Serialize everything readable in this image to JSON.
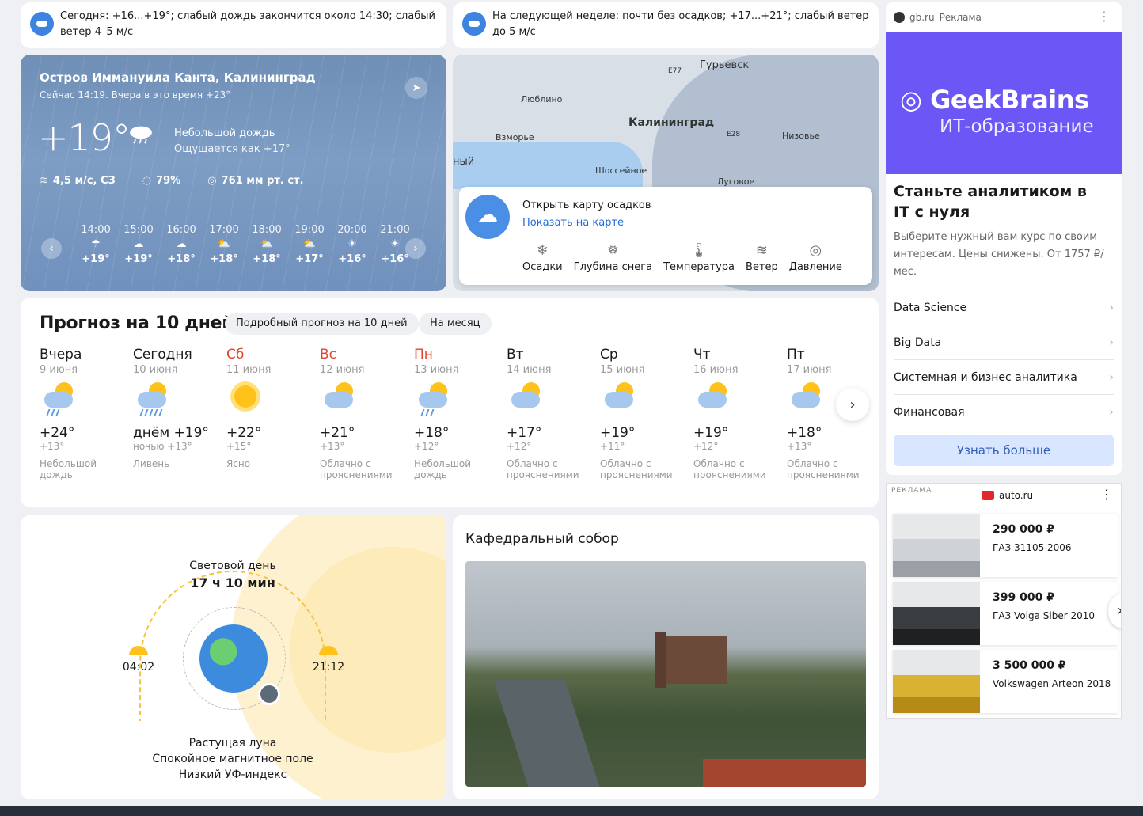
{
  "notices": [
    {
      "text": "Сегодня: +16...+19°; слабый дождь закончится около 14:30; слабый ветер 4–5 м/с"
    },
    {
      "text": "На следующей неделе: почти без осадков; +17...+21°; слабый ветер до 5 м/с"
    }
  ],
  "current": {
    "location": "Остров Иммануила Канта, Калининград",
    "now_line": "Сейчас 14:19. Вчера в это время +23°",
    "temp": "+19°",
    "condition": "Небольшой дождь",
    "feels_like": "Ощущается как +17°",
    "wind": "4,5 м/с, СЗ",
    "humidity": "79%",
    "pressure": "761 мм рт. ст.",
    "hourly": [
      {
        "time": "14:00",
        "temp": "+19°",
        "icon": "rain-cloud-icon"
      },
      {
        "time": "15:00",
        "temp": "+19°",
        "icon": "cloud-icon"
      },
      {
        "time": "16:00",
        "temp": "+18°",
        "icon": "cloud-icon"
      },
      {
        "time": "17:00",
        "temp": "+18°",
        "icon": "partly-cloudy-icon"
      },
      {
        "time": "18:00",
        "temp": "+18°",
        "icon": "partly-cloudy-icon"
      },
      {
        "time": "19:00",
        "temp": "+17°",
        "icon": "partly-cloudy-icon"
      },
      {
        "time": "20:00",
        "temp": "+16°",
        "icon": "sun-icon"
      },
      {
        "time": "21:00",
        "temp": "+16°",
        "icon": "sun-icon"
      }
    ]
  },
  "map": {
    "labels": {
      "guryevsk": "Гурьевск",
      "lyublino": "Люблино",
      "kaliningrad": "Калининград",
      "vzmorye": "Взморье",
      "nizovye": "Низовье",
      "shosseynoye": "Шоссейное",
      "lugovoe": "Луговое",
      "e77": "E77",
      "e28": "E28",
      "left_edge": "ный"
    },
    "open_text": "Открыть карту осадков",
    "show_link": "Показать на карте",
    "layers": [
      "Осадки",
      "Глубина снега",
      "Температура",
      "Ветер",
      "Давление"
    ]
  },
  "forecast": {
    "title": "Прогноз на 10 дней",
    "pill_detailed": "Подробный прогноз на 10 дней",
    "pill_month": "На месяц",
    "days": [
      {
        "name": "Вчера",
        "date": "9 июня",
        "hi": "+24°",
        "lo": "+13°",
        "cond": "Небольшой дождь",
        "red": false,
        "icon": "rain"
      },
      {
        "name": "Сегодня",
        "date": "10 июня",
        "hi": "днём +19°",
        "lo": "ночью +13°",
        "cond": "Ливень",
        "red": false,
        "icon": "shower"
      },
      {
        "name": "Сб",
        "date": "11 июня",
        "hi": "+22°",
        "lo": "+15°",
        "cond": "Ясно",
        "red": true,
        "icon": "sun"
      },
      {
        "name": "Вс",
        "date": "12 июня",
        "hi": "+21°",
        "lo": "+13°",
        "cond": "Облачно с прояснениями",
        "red": true,
        "icon": "partly"
      },
      {
        "name": "Пн",
        "date": "13 июня",
        "hi": "+18°",
        "lo": "+12°",
        "cond": "Небольшой дождь",
        "red": true,
        "icon": "rain"
      },
      {
        "name": "Вт",
        "date": "14 июня",
        "hi": "+17°",
        "lo": "+12°",
        "cond": "Облачно с прояснениями",
        "red": false,
        "icon": "partly"
      },
      {
        "name": "Ср",
        "date": "15 июня",
        "hi": "+19°",
        "lo": "+11°",
        "cond": "Облачно с прояснениями",
        "red": false,
        "icon": "partly"
      },
      {
        "name": "Чт",
        "date": "16 июня",
        "hi": "+19°",
        "lo": "+12°",
        "cond": "Облачно с прояснениями",
        "red": false,
        "icon": "partly"
      },
      {
        "name": "Пт",
        "date": "17 июня",
        "hi": "+18°",
        "lo": "+13°",
        "cond": "Облачно с прояснениями",
        "red": false,
        "icon": "partly"
      }
    ]
  },
  "daylight": {
    "label": "Световой день",
    "duration": "17 ч 10 мин",
    "sunrise": "04:02",
    "sunset": "21:12",
    "moon": "Растущая луна",
    "magnetic": "Спокойное магнитное поле",
    "uv": "Низкий УФ-индекс"
  },
  "cathedral": {
    "title": "Кафедральный собор"
  },
  "ad_geekbrains": {
    "source": "gb.ru",
    "ad_label": "Реклама",
    "brand": "GeekBrains",
    "brand_sub": "ИТ-образование",
    "headline": "Станьте аналитиком в IT с нуля",
    "description": "Выберите нужный вам курс по своим интересам. Цены снижены. От 1757 ₽/мес.",
    "links": [
      "Data Science",
      "Big Data",
      "Системная и бизнес аналитика",
      "Финансовая"
    ],
    "cta": "Узнать больше",
    "color": "#6a57f5"
  },
  "ad_auto": {
    "ad_label": "РЕКЛАМА",
    "source": "auto.ru",
    "cars": [
      {
        "price": "290 000 ₽",
        "model": "ГАЗ 31105 2006"
      },
      {
        "price": "399 000 ₽",
        "model": "ГАЗ Volga Siber 2010"
      },
      {
        "price": "3 500 000 ₽",
        "model": "Volkswagen Arteon 2018"
      }
    ]
  }
}
